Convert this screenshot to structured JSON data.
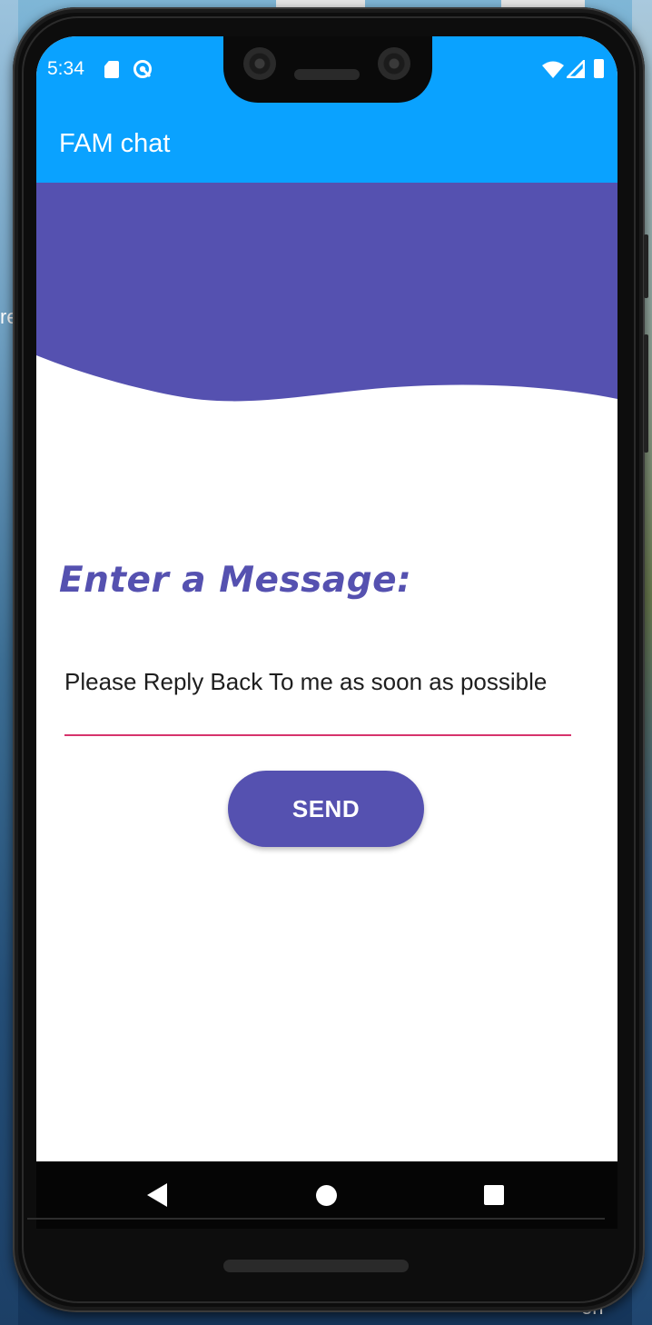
{
  "desktop": {
    "left_edge_text": "re",
    "bottom_text": "on"
  },
  "status_bar": {
    "time": "5:34",
    "icons": [
      "sd-card-icon",
      "sync-icon",
      "wifi-icon",
      "signal-icon",
      "battery-icon"
    ]
  },
  "app_bar": {
    "title": "FAM chat"
  },
  "main": {
    "heading": "Enter a Message:",
    "message_value": "Please Reply Back To me as soon as possible",
    "send_label": "SEND"
  },
  "nav_bar": {
    "icons": [
      "back-icon",
      "home-icon",
      "recents-icon"
    ]
  },
  "colors": {
    "app_bar": "#0aa2ff",
    "wave": "#5551b0",
    "accent": "#5551b0",
    "underline": "#d6336c"
  }
}
